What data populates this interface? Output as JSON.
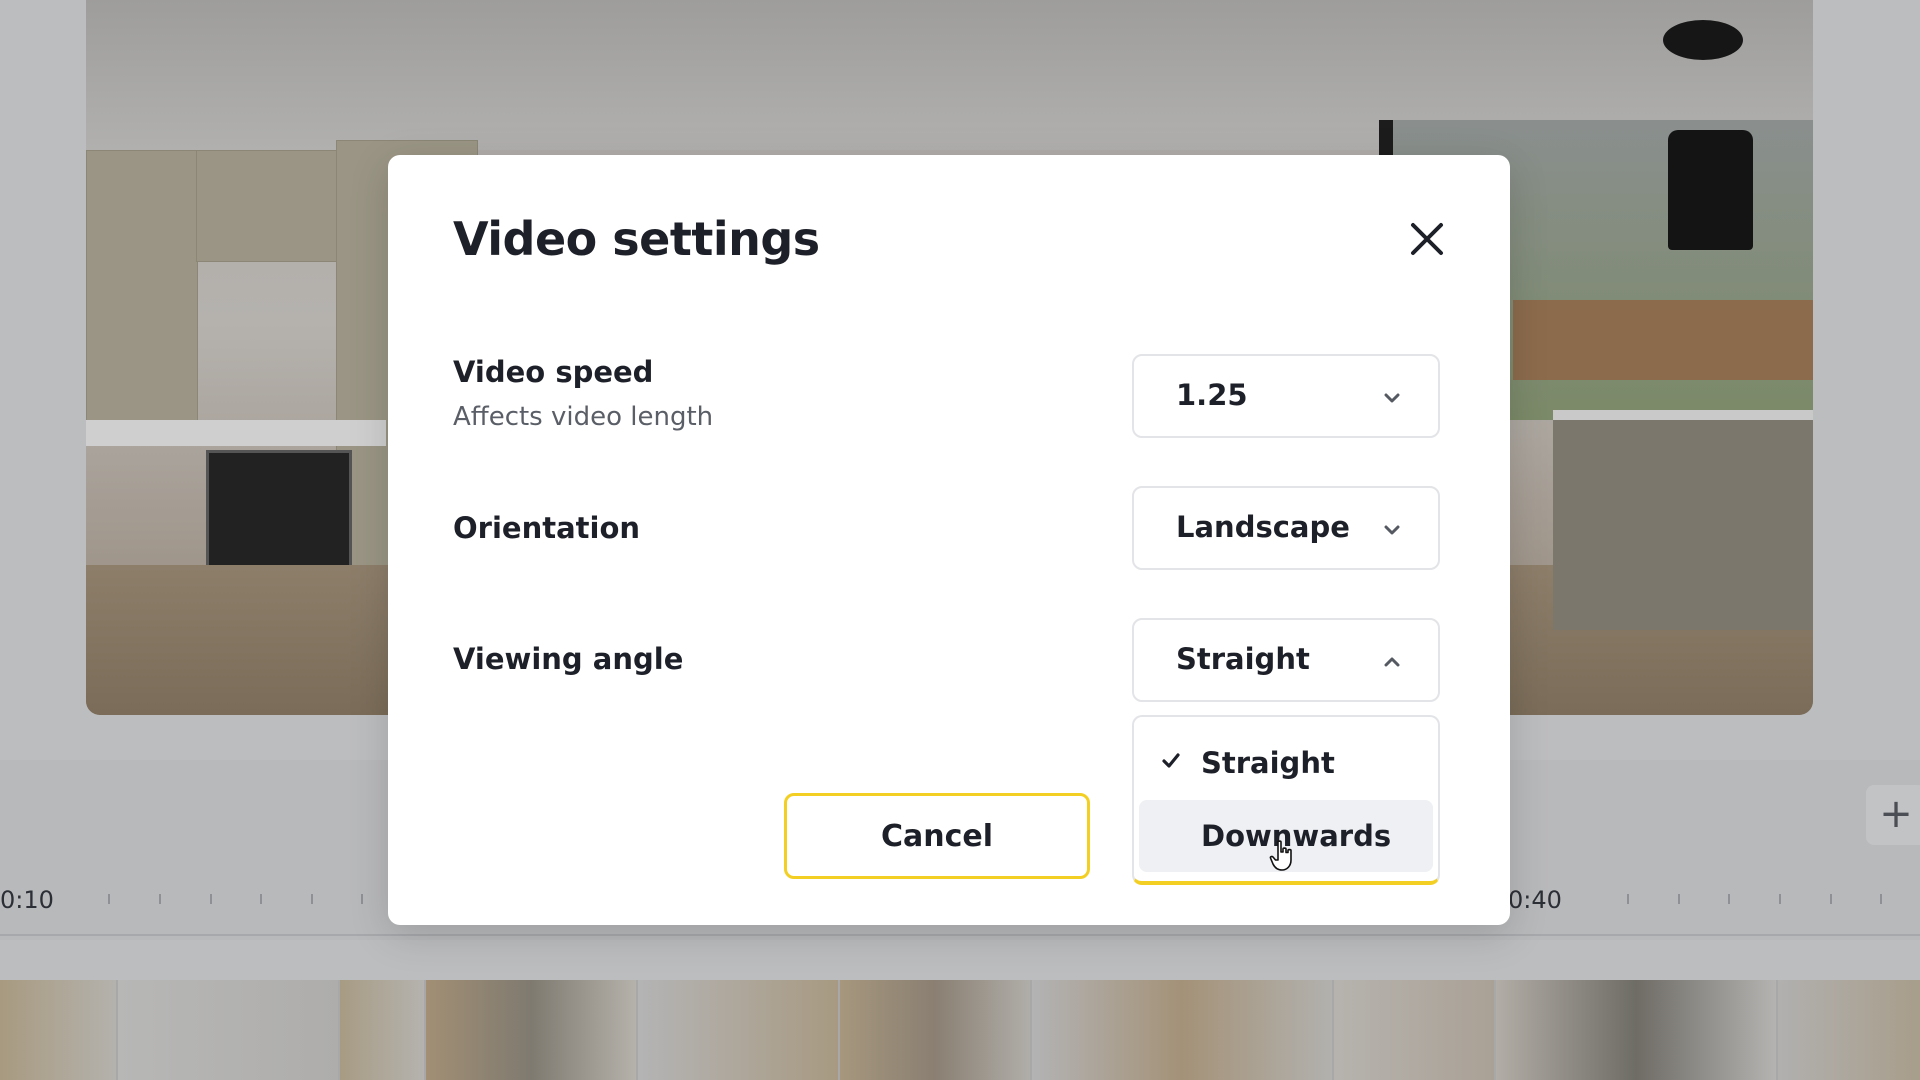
{
  "timeline": {
    "time_left": "0:10",
    "time_right": "0:40",
    "add_icon": "plus-icon"
  },
  "modal": {
    "title": "Video settings",
    "close_icon": "close-icon",
    "video_speed": {
      "label": "Video speed",
      "sublabel": "Affects video length",
      "value": "1.25"
    },
    "orientation": {
      "label": "Orientation",
      "value": "Landscape"
    },
    "viewing_angle": {
      "label": "Viewing angle",
      "value": "Straight",
      "options": [
        {
          "label": "Straight",
          "selected": true
        },
        {
          "label": "Downwards",
          "selected": false,
          "hovered": true
        }
      ]
    },
    "cancel_label": "Cancel"
  },
  "colors": {
    "accent_yellow": "#f3cf24",
    "text_dark": "#1d2028",
    "overlay_gray": "#bcbdbf"
  }
}
